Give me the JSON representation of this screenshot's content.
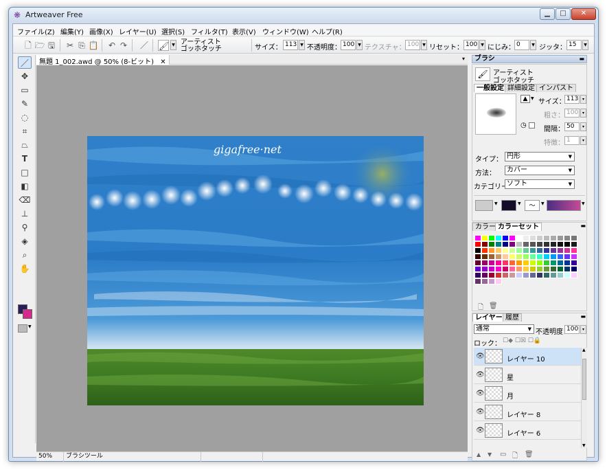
{
  "window": {
    "title": "Artweaver Free",
    "controls": {
      "minimize": "▁",
      "maximize": "□",
      "close": "✕"
    }
  },
  "menu": [
    "ファイル(Z)",
    "編集(Y)",
    "画像(X)",
    "レイヤー(U)",
    "選択(S)",
    "フィルタ(T)",
    "表示(V)",
    "ウィンドウ(W)",
    "ヘルプ(R)"
  ],
  "toolbar": {
    "brush_category": "アーティスト",
    "brush_variant": "ゴッホタッチ",
    "size_label": "サイズ：",
    "size_value": "113",
    "opacity_label": "不透明度：",
    "opacity_value": "100",
    "texture_label": "テクスチャ：",
    "texture_value": "100",
    "reset_label": "リセット：",
    "reset_value": "100",
    "blur_label": "にじみ：",
    "blur_value": "0",
    "jitter_label": "ジッタ：",
    "jitter_value": "15"
  },
  "document": {
    "tab_title": "無題 1_002.awd @ 50% (8-ビット)",
    "close_glyph": "✕",
    "canvas_text": "gigafree·net"
  },
  "status": {
    "zoom": "50%",
    "tool_name": "ブラシツール"
  },
  "brush_panel": {
    "title": "ブラシ",
    "category": "アーティスト",
    "variant": "ゴッホタッチ",
    "tabs": [
      "一般設定",
      "詳細設定",
      "インパスト"
    ],
    "size_label": "サイズ：",
    "size_value": "113",
    "roughness_label": "粗さ：",
    "roughness_value": "100",
    "spacing_label": "間隔：",
    "spacing_value": "50",
    "feature_label": "特徴：",
    "feature_value": "1",
    "type_label": "タイプ：",
    "type_value": "円形",
    "method_label": "方法：",
    "method_value": "カバー",
    "category_label": "カテゴリー",
    "category_value": "ソフト"
  },
  "color_panel": {
    "tabs": [
      "カラー",
      "カラーセット"
    ],
    "swatches": [
      "#ff00ff",
      "#ffff00",
      "#00ff00",
      "#00ffff",
      "#0000ff",
      "#ff00ff",
      "#ffffff",
      "#eeeeee",
      "#dddddd",
      "#cccccc",
      "#bbbbbb",
      "#aaaaaa",
      "#999999",
      "#888888",
      "#777777",
      "#ff0000",
      "#800000",
      "#008000",
      "#008080",
      "#000080",
      "#800080",
      "#c0c0c0",
      "#666666",
      "#555555",
      "#444444",
      "#333333",
      "#222222",
      "#111111",
      "#000000",
      "#1a1a1a",
      "#000000",
      "#ff3300",
      "#ff9933",
      "#ffcc66",
      "#ffff99",
      "#ccff99",
      "#99ff99",
      "#66cc99",
      "#339999",
      "#336699",
      "#333399",
      "#663399",
      "#993399",
      "#cc3399",
      "#ff3399",
      "#330000",
      "#663300",
      "#996633",
      "#cc9966",
      "#ffcc99",
      "#ffff66",
      "#ccff66",
      "#99ff66",
      "#66ff99",
      "#33ffcc",
      "#00ccff",
      "#0099ff",
      "#3366ff",
      "#6633ff",
      "#cc33ff",
      "#660033",
      "#990066",
      "#cc0099",
      "#ff0099",
      "#ff3366",
      "#ff6633",
      "#ff9900",
      "#ffcc00",
      "#ccff00",
      "#99ff00",
      "#33cc33",
      "#009966",
      "#006699",
      "#003399",
      "#330099",
      "#6600cc",
      "#9900cc",
      "#cc00cc",
      "#ff00cc",
      "#cc0066",
      "#ff6699",
      "#ff9966",
      "#ffcc33",
      "#cccc00",
      "#99cc33",
      "#669933",
      "#336633",
      "#006633",
      "#003366",
      "#000066",
      "#330066",
      "#660066",
      "#990033",
      "#cc3333",
      "#cc6666",
      "#cc9999",
      "#ccccff",
      "#9999cc",
      "#666699",
      "#333366",
      "#336666",
      "#669999",
      "#99cccc",
      "#ccffff",
      "#ffccff",
      "#663366",
      "#996699",
      "#cc99cc",
      "#ffccee"
    ]
  },
  "layers_panel": {
    "tabs": [
      "レイヤー",
      "履歴"
    ],
    "blend_mode": "通常",
    "opacity_label": "不透明度：",
    "opacity_value": "100",
    "lock_label": "ロック：",
    "layers": [
      {
        "name": "レイヤー 10",
        "selected": true
      },
      {
        "name": "星",
        "selected": false
      },
      {
        "name": "月",
        "selected": false
      },
      {
        "name": "レイヤー 8",
        "selected": false
      },
      {
        "name": "レイヤー 6",
        "selected": false
      }
    ]
  }
}
